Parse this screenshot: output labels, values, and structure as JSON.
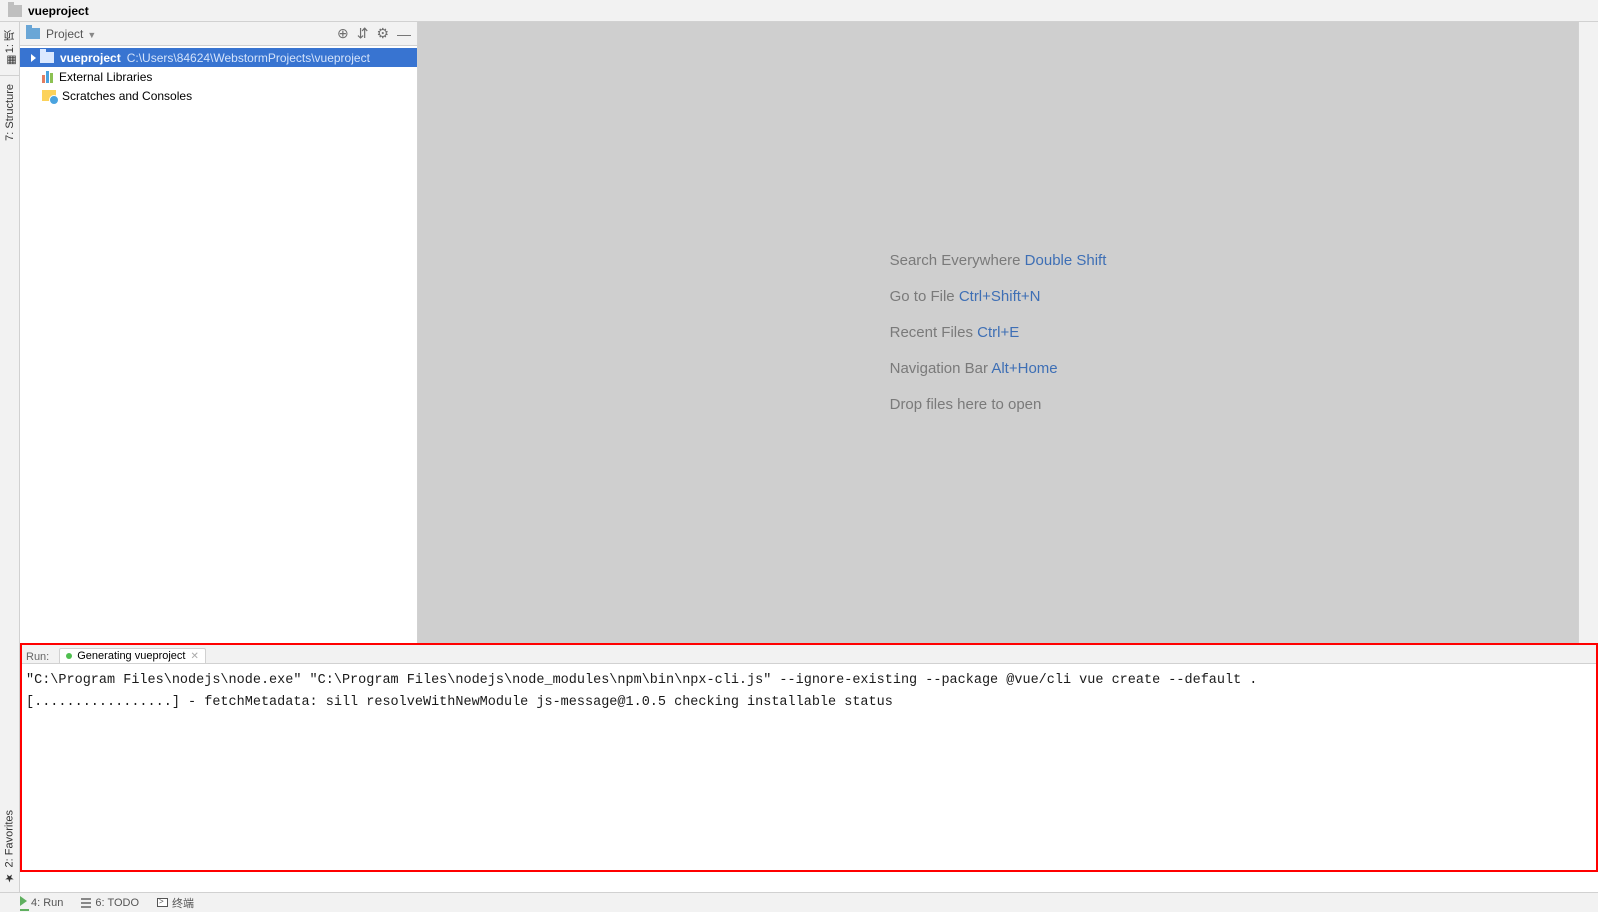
{
  "breadcrumb": {
    "project": "vueproject"
  },
  "left_gutter": {
    "tab1": "1: 项",
    "tab2": "7: Structure"
  },
  "project_panel": {
    "title": "Project",
    "actions": {
      "target": "⊕",
      "collapse": "⇵",
      "gear": "⚙",
      "hide": "—"
    },
    "tree": {
      "root": {
        "name": "vueproject",
        "path": "C:\\Users\\84624\\WebstormProjects\\vueproject"
      },
      "external": "External Libraries",
      "scratches": "Scratches and Consoles"
    }
  },
  "editor_hints": {
    "rows": [
      {
        "label": "Search Everywhere ",
        "shortcut": "Double Shift"
      },
      {
        "label": "Go to File ",
        "shortcut": "Ctrl+Shift+N"
      },
      {
        "label": "Recent Files ",
        "shortcut": "Ctrl+E"
      },
      {
        "label": "Navigation Bar ",
        "shortcut": "Alt+Home"
      },
      {
        "label": "Drop files here to open",
        "shortcut": ""
      }
    ]
  },
  "run_panel": {
    "label": "Run:",
    "tab": "Generating vueproject",
    "line1": "\"C:\\Program Files\\nodejs\\node.exe\" \"C:\\Program Files\\nodejs\\node_modules\\npm\\bin\\npx-cli.js\" --ignore-existing --package @vue/cli vue create --default .",
    "line2": "[.................] - fetchMetadata: sill resolveWithNewModule js-message@1.0.5 checking installable status"
  },
  "left_gutter_bottom": {
    "favorites": "2: Favorites"
  },
  "status_bar": {
    "run": "4: Run",
    "todo": "6: TODO",
    "terminal": "终端"
  }
}
